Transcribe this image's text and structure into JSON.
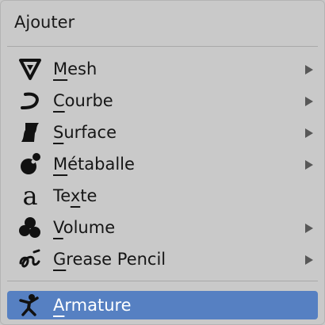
{
  "menu": {
    "title": "Ajouter",
    "items": [
      {
        "first": "M",
        "rest": "esh",
        "icon": "mesh-icon",
        "submenu": true
      },
      {
        "first": "C",
        "rest": "ourbe",
        "icon": "curve-icon",
        "submenu": true
      },
      {
        "first": "S",
        "rest": "urface",
        "icon": "surface-icon",
        "submenu": true
      },
      {
        "first": "M",
        "rest": "étaballe",
        "icon": "metaball-icon",
        "submenu": true
      },
      {
        "pre": "Te",
        "first": "x",
        "rest": "te",
        "icon": "text-icon",
        "submenu": false
      },
      {
        "first": "V",
        "rest": "olume",
        "icon": "volume-icon",
        "submenu": true
      },
      {
        "first": "G",
        "rest": "rease Pencil",
        "icon": "grease-pencil-icon",
        "submenu": true
      }
    ],
    "armature": {
      "first": "A",
      "rest": "rmature",
      "icon": "armature-icon",
      "submenu": false,
      "highlighted": true
    }
  },
  "colors": {
    "background": "#c9c9c9",
    "highlight": "#5680c2",
    "text": "#161616",
    "arrow": "#585858"
  }
}
